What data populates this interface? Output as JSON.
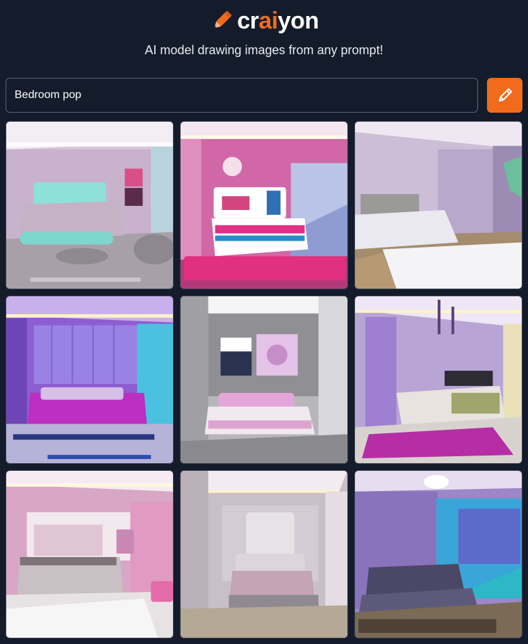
{
  "header": {
    "logo_pre": "cr",
    "logo_accent": "ai",
    "logo_post": "yon",
    "logo_icon": "pencil-icon",
    "tagline": "AI model drawing images from any prompt!"
  },
  "prompt": {
    "value": "Bedroom pop",
    "button_icon": "pencil-icon"
  },
  "colors": {
    "background": "#141c2b",
    "accent": "#f26b1d",
    "input_border": "#5b6475"
  },
  "results": {
    "count_label": "",
    "images": [
      {
        "name": "bedroom-image-1"
      },
      {
        "name": "bedroom-image-2"
      },
      {
        "name": "bedroom-image-3"
      },
      {
        "name": "bedroom-image-4"
      },
      {
        "name": "bedroom-image-5"
      },
      {
        "name": "bedroom-image-6"
      },
      {
        "name": "bedroom-image-7"
      },
      {
        "name": "bedroom-image-8"
      },
      {
        "name": "bedroom-image-9"
      }
    ]
  }
}
